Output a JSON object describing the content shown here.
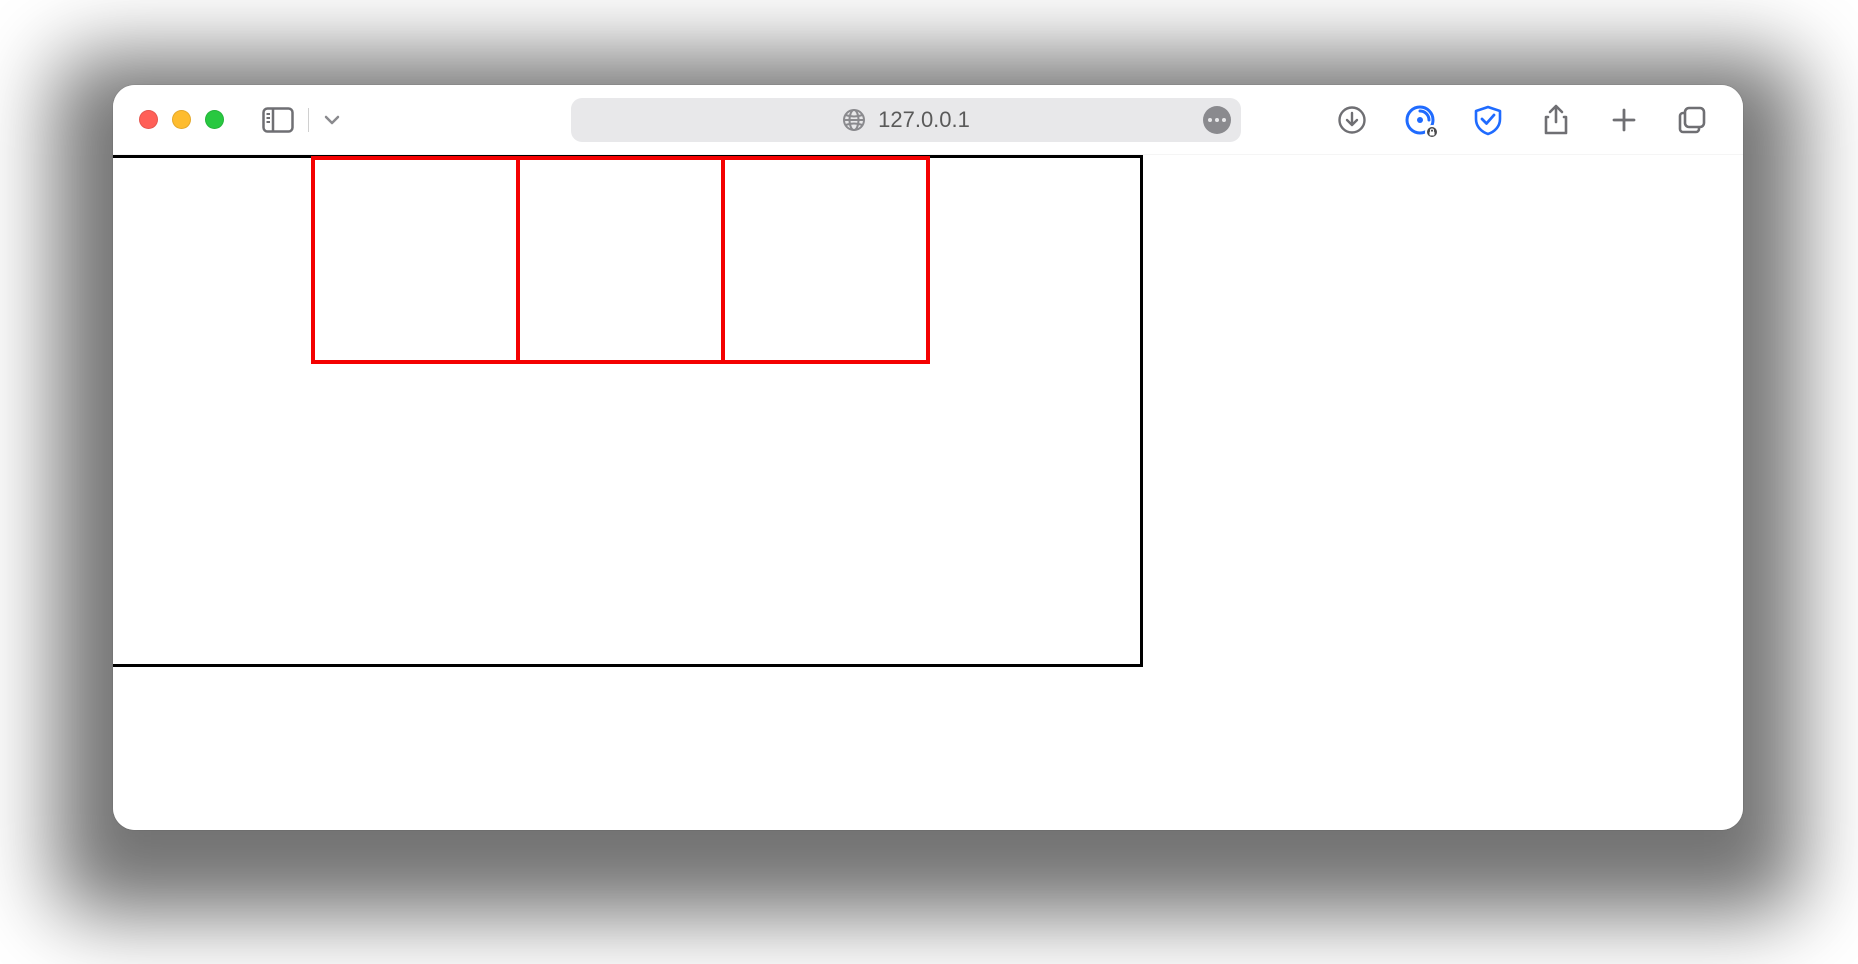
{
  "browser": {
    "address": "127.0.0.1"
  },
  "content": {
    "parent_border_color": "#000000",
    "child_border_color": "#f40101",
    "child_count": 3
  }
}
